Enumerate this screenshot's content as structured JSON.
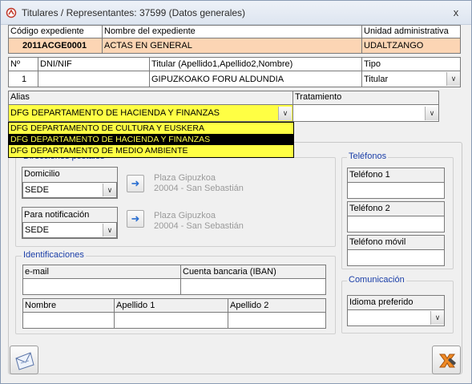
{
  "window": {
    "title": "Titulares / Representantes: 37599 (Datos generales)",
    "close_glyph": "x"
  },
  "expediente": {
    "codigo_label": "Código expediente",
    "codigo_value": "2011ACGE0001",
    "nombre_label": "Nombre del expediente",
    "nombre_value": "ACTAS EN GENERAL",
    "unidad_label": "Unidad administrativa",
    "unidad_value": "UDALTZANGO"
  },
  "titular": {
    "num_label": "Nº",
    "num_value": "1",
    "dni_label": "DNI/NIF",
    "dni_value": "",
    "titular_label": "Titular (Apellido1,Apellido2,Nombre)",
    "titular_value": "GIPUZKOAKO FORU ALDUNDIA",
    "tipo_label": "Tipo",
    "tipo_value": "Titular"
  },
  "alias": {
    "label": "Alias",
    "value": "DFG DEPARTAMENTO DE HACIENDA Y FINANZAS",
    "options": [
      "DFG DEPARTAMENTO DE CULTURA Y EUSKERA",
      "DFG DEPARTAMENTO DE HACIENDA Y FINANZAS",
      "DFG DEPARTAMENTO DE MEDIO AMBIENTE"
    ],
    "selected_index": 1
  },
  "tratamiento": {
    "label": "Tratamiento",
    "value": ""
  },
  "direcciones": {
    "title": "Direcciones postales",
    "domicilio_label": "Domicilio",
    "domicilio_value": "SEDE",
    "domicilio_addr1": "Plaza Gipuzkoa",
    "domicilio_addr2": "20004 - San Sebastián",
    "notif_label": "Para notificación",
    "notif_value": "SEDE",
    "notif_addr1": "Plaza Gipuzkoa",
    "notif_addr2": "20004 - San Sebastián"
  },
  "identificaciones": {
    "title": "Identificaciones",
    "email_label": "e-mail",
    "email_value": "",
    "iban_label": "Cuenta bancaria (IBAN)",
    "iban_value": "",
    "nombre_label": "Nombre",
    "apellido1_label": "Apellido 1",
    "apellido2_label": "Apellido 2"
  },
  "telefonos": {
    "title": "Teléfonos",
    "tel1_label": "Teléfono 1",
    "tel2_label": "Teléfono 2",
    "movil_label": "Teléfono móvil"
  },
  "comunicacion": {
    "title": "Comunicación",
    "idioma_label": "Idioma preferido",
    "idioma_value": ""
  },
  "icons": {
    "title": "app-icon",
    "send": "envelope-icon",
    "exit": "exit-icon",
    "arrow": "arrow-right-icon"
  },
  "colors": {
    "header_row": "#fcd5b4",
    "alias_highlight": "#ffff44",
    "selected_option_bg": "#000000",
    "selected_option_fg": "#ffff44",
    "group_title": "#1a3ea8"
  }
}
